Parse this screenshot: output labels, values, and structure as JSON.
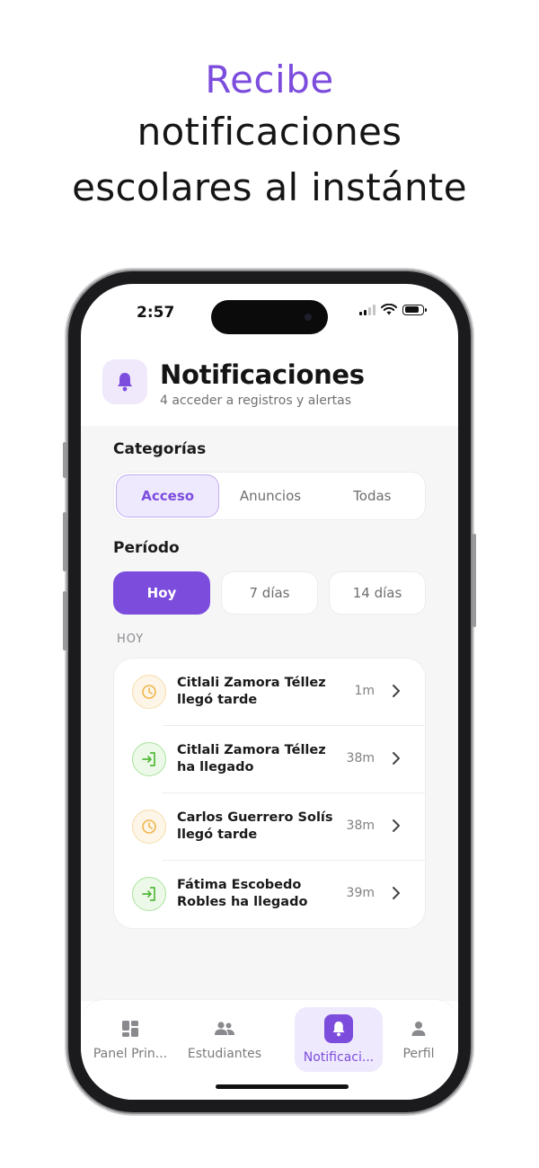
{
  "headline": {
    "accent": "Recibe",
    "line1": "notificaciones",
    "line2": "escolares al instánte"
  },
  "status_bar": {
    "time": "2:57",
    "icons": [
      "signal-icon",
      "wifi-icon",
      "battery-icon"
    ]
  },
  "header": {
    "icon": "bell-icon",
    "title": "Notificaciones",
    "subtitle": "4 acceder a registros y alertas"
  },
  "categories": {
    "label": "Categorías",
    "items": [
      {
        "label": "Acceso",
        "active": true
      },
      {
        "label": "Anuncios",
        "active": false
      },
      {
        "label": "Todas",
        "active": false
      }
    ]
  },
  "period": {
    "label": "Período",
    "items": [
      {
        "label": "Hoy",
        "active": true
      },
      {
        "label": "7 días",
        "active": false
      },
      {
        "label": "14 días",
        "active": false
      }
    ]
  },
  "section_today": "HOY",
  "notifications": [
    {
      "type": "late",
      "icon": "clock-icon",
      "text": "Citlali Zamora Téllez llegó tarde",
      "time": "1m"
    },
    {
      "type": "arrive",
      "icon": "login-icon",
      "text": "Citlali Zamora Téllez ha llegado",
      "time": "38m"
    },
    {
      "type": "late",
      "icon": "clock-icon",
      "text": "Carlos Guerrero Solís llegó tarde",
      "time": "38m"
    },
    {
      "type": "arrive",
      "icon": "login-icon",
      "text": "Fátima Escobedo Robles ha llegado",
      "time": "39m"
    }
  ],
  "tabbar": [
    {
      "label": "Panel Prin...",
      "icon": "dashboard-icon",
      "active": false
    },
    {
      "label": "Estudiantes",
      "icon": "students-icon",
      "active": false
    },
    {
      "label": "Notificaci...",
      "icon": "bell-icon",
      "active": true
    },
    {
      "label": "Perfil",
      "icon": "profile-icon",
      "active": false
    }
  ],
  "colors": {
    "accent": "#7c4ddd",
    "late": "#f0b44c",
    "arrive": "#52b83a"
  }
}
